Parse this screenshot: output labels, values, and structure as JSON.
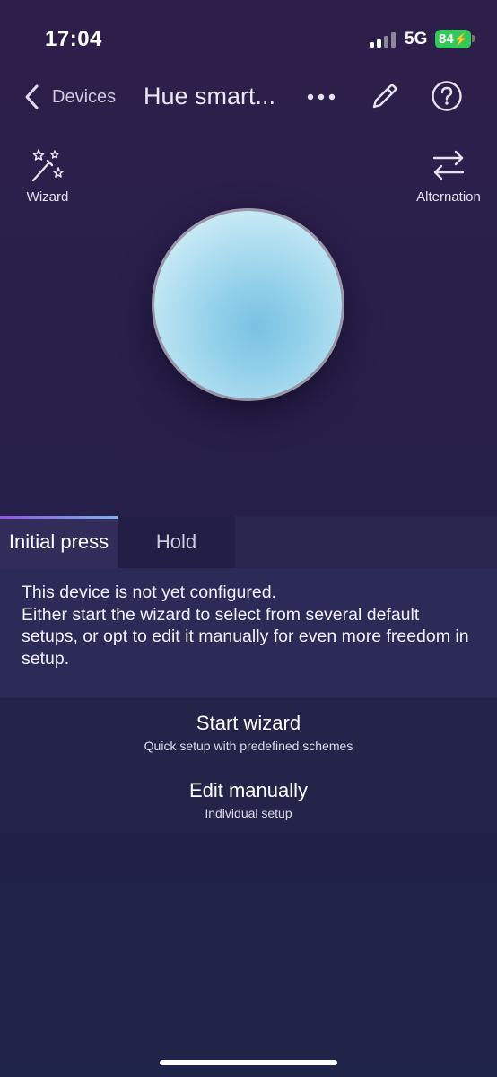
{
  "status_bar": {
    "time": "17:04",
    "network": "5G",
    "battery": "84",
    "battery_color": "#34c759"
  },
  "nav": {
    "back_label": "Devices",
    "title": "Hue smart...",
    "icons": [
      "chevron-left-icon",
      "more-icon",
      "pencil-icon",
      "help-icon"
    ]
  },
  "side_actions": {
    "wizard_label": "Wizard",
    "alternation_label": "Alternation"
  },
  "tabs": [
    {
      "label": "Initial press",
      "selected": true
    },
    {
      "label": "Hold",
      "selected": false
    }
  ],
  "info": {
    "line1": "This device is not yet configured.",
    "line2": "Either start the wizard to select from several default setups, or opt to edit it manually for even more freedom in setup."
  },
  "actions": {
    "start_wizard": {
      "title": "Start wizard",
      "subtitle": "Quick setup with predefined schemes"
    },
    "edit_manually": {
      "title": "Edit manually",
      "subtitle": "Individual setup"
    }
  },
  "colors": {
    "accent_gradient_start": "#8a56d8",
    "accent_gradient_end": "#7fb0f0",
    "orb_color": "#94d1ea"
  }
}
